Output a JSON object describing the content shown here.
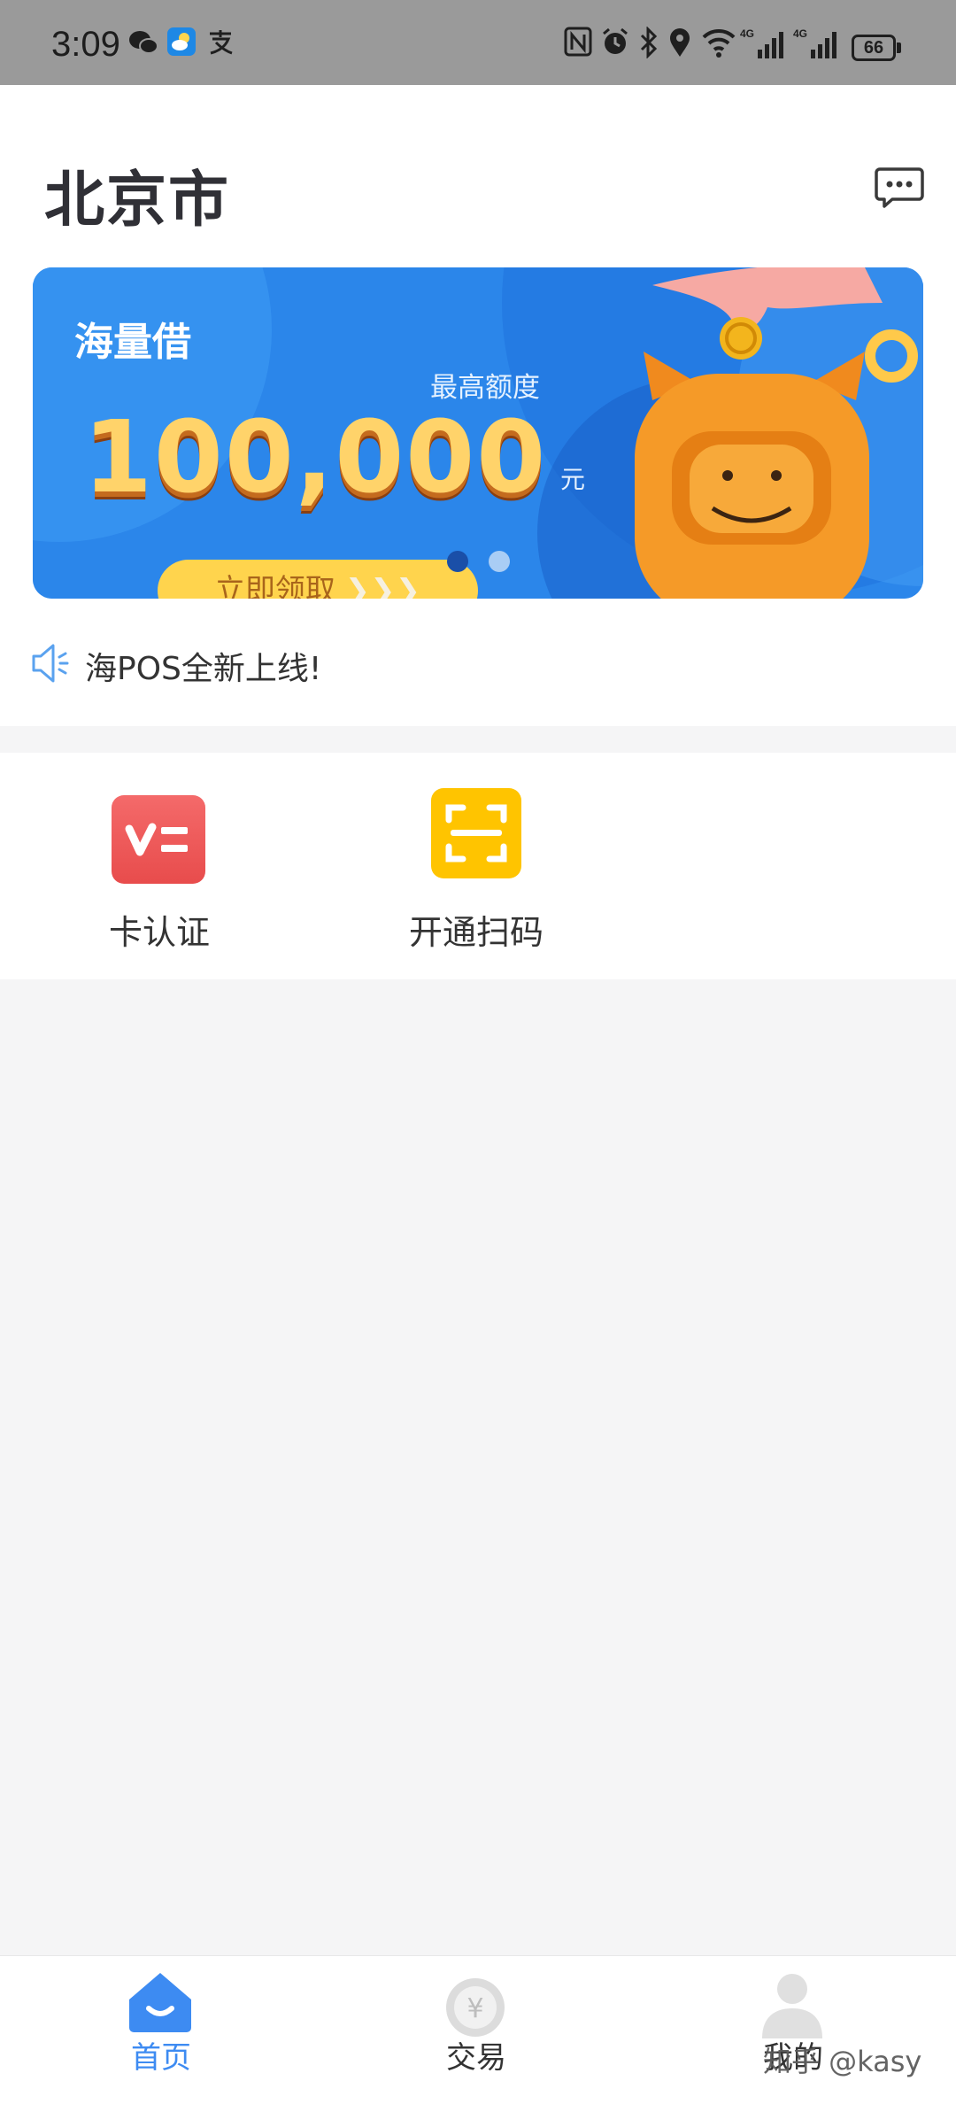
{
  "status_bar": {
    "time": "3:09",
    "battery": "66",
    "icons": [
      "wechat-icon",
      "weather-app-icon",
      "alipay-icon",
      "nfc-icon",
      "alarm-icon",
      "bluetooth-icon",
      "location-icon",
      "wifi-icon",
      "signal-4g-icon",
      "signal-4g-icon"
    ]
  },
  "header": {
    "city": "北京市",
    "message_icon": "chat-bubble-icon"
  },
  "banner": {
    "title": "海量借",
    "subtitle": "最高额度",
    "amount": "100,000",
    "unit": "元",
    "cta": "立即领取",
    "page_count": 2,
    "active_page": 1
  },
  "notice": {
    "icon": "speaker-icon",
    "text": "海POS全新上线!"
  },
  "quick_actions": [
    {
      "label": "卡认证",
      "icon": "card-verify-icon",
      "color": "#ef5b5b"
    },
    {
      "label": "开通扫码",
      "icon": "scan-icon",
      "color": "#ffc400"
    }
  ],
  "tab_bar": {
    "tabs": [
      {
        "label": "首页",
        "icon": "home-icon",
        "active": true
      },
      {
        "label": "交易",
        "icon": "yuan-coin-icon",
        "active": false
      },
      {
        "label": "我的",
        "icon": "user-icon",
        "active": false
      }
    ],
    "active_color": "#3d8bf2",
    "inactive_color": "#333333"
  },
  "watermark": "知乎 @kasy"
}
